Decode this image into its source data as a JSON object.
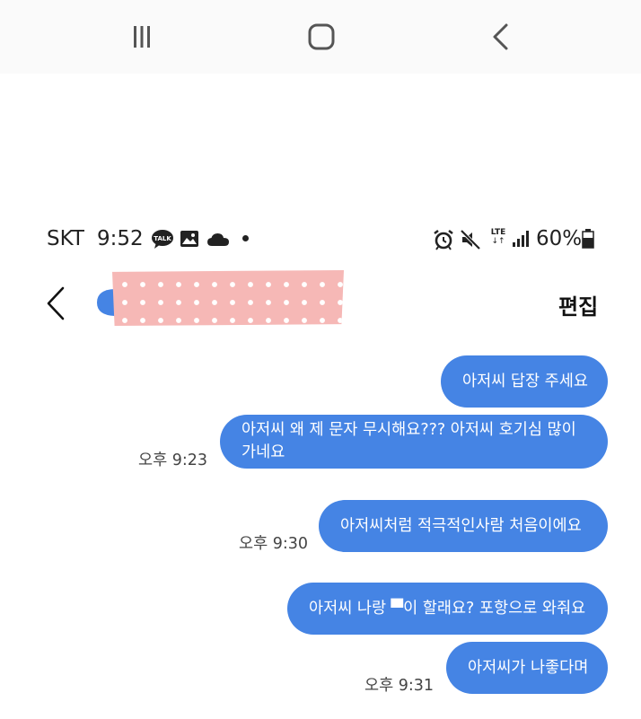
{
  "navbar": {
    "recent_icon": "recent-apps-icon",
    "home_icon": "home-icon",
    "back_icon": "back-icon"
  },
  "status_bar": {
    "carrier": "SKT",
    "time": "9:52",
    "icons": [
      "kakaotalk-icon",
      "gallery-icon",
      "cloud-icon",
      "dot-icon",
      "alarm-icon",
      "mute-icon",
      "lte-icon",
      "signal-icon",
      "battery-icon"
    ],
    "lte_label": "LTE",
    "lte_arrows": "↓↑",
    "talk_label": "TALK",
    "battery": "60%"
  },
  "header": {
    "back_icon": "chevron-left-icon",
    "edit_label": "편집",
    "avatar_color": "#4584e4",
    "redaction_color": "#f6b8b6"
  },
  "messages": [
    {
      "text": "아저씨 답장 주세요",
      "time": ""
    },
    {
      "text": "아저씨 왜 제 문자 무시해요??? 아저씨 호기심 많이가네요",
      "time": "오후 9:23"
    },
    {
      "text": "아저씨처럼 적극적인사람 처음이에요",
      "time": "오후 9:30"
    },
    {
      "text": "아저씨 나랑 ▀이 할래요? 포항으로 와줘요",
      "time": ""
    },
    {
      "text": "아저씨가 나좋다며",
      "time": "오후 9:31"
    }
  ],
  "colors": {
    "bubble": "#4584e4",
    "bubble_text": "#ffffff"
  }
}
